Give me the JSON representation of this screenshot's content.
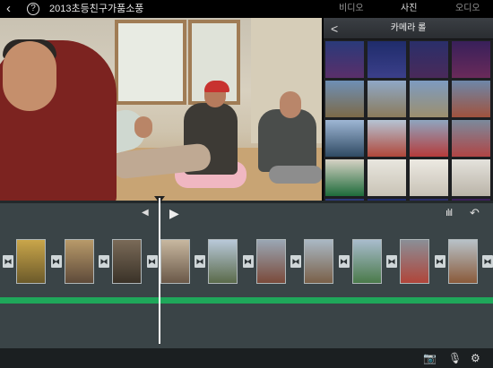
{
  "header": {
    "back_icon": "chevron-left-icon",
    "help_label": "?",
    "title": "2013초등친구가품소풍",
    "tabs": [
      {
        "label": "비디오"
      },
      {
        "label": "사진"
      },
      {
        "label": "오디오"
      }
    ]
  },
  "camera_roll": {
    "back_label": "<",
    "title": "카메라 롤",
    "thumb_count_visible": 20
  },
  "timeline": {
    "prev_label": "◀",
    "play_label": "▶",
    "audio_waveform_icon": "waveform-icon",
    "undo_icon": "undo-icon",
    "clips": [
      {
        "id": "clip-1"
      },
      {
        "id": "clip-2"
      },
      {
        "id": "clip-3"
      },
      {
        "id": "clip-4"
      },
      {
        "id": "clip-5"
      },
      {
        "id": "clip-6"
      },
      {
        "id": "clip-7"
      },
      {
        "id": "clip-8"
      },
      {
        "id": "clip-9"
      },
      {
        "id": "clip-10"
      }
    ],
    "transition_label": "⧓",
    "accent_color": "#1fa75a"
  },
  "bottom_bar": {
    "camera_icon": "camera-icon",
    "mic_icon": "microphone-icon",
    "settings_icon": "gear-icon"
  }
}
